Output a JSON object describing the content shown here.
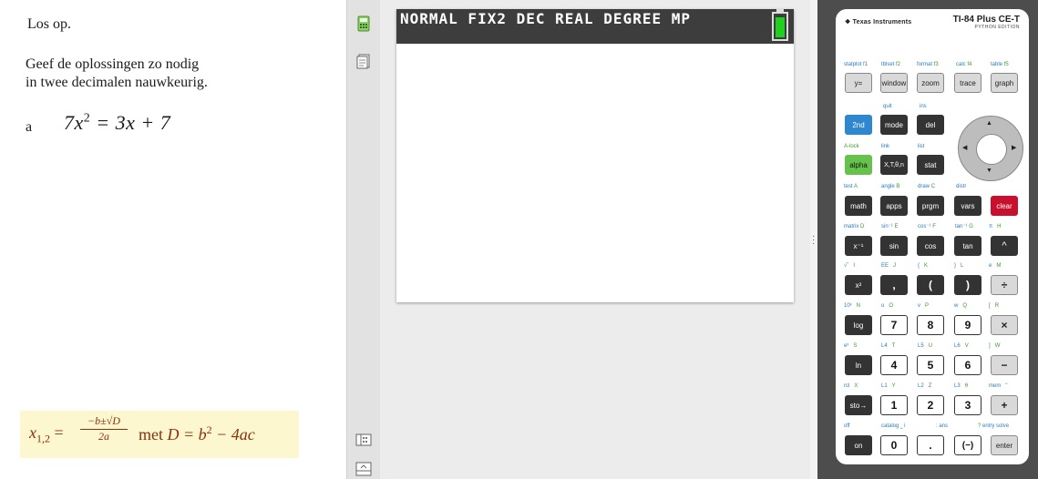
{
  "left": {
    "instruction": "Los op.",
    "precision_line1": "Geef de oplossingen zo nodig",
    "precision_line2": "in twee decimalen nauwkeurig.",
    "question_label": "a",
    "equation_base": "7x",
    "equation_exp": "2",
    "equation_rest": " = 3x + 7",
    "formula_lhs": "x",
    "formula_sub": "1,2",
    "formula_eq": " =",
    "formula_num": "−b±√D",
    "formula_den": "2a",
    "formula_met": "met",
    "formula_D": "D = b",
    "formula_D_exp": "2",
    "formula_D_rest": " − 4ac"
  },
  "screen": {
    "status": "NORMAL FIX2 DEC REAL DEGREE MP"
  },
  "calc": {
    "brand": "Texas Instruments",
    "model": "TI-84 Plus CE-T",
    "edition": "PYTHON EDITION",
    "labels": {
      "statplot": "statplot",
      "f1": "f1",
      "tblset": "tblset",
      "f2": "f2",
      "format": "format",
      "f3": "f3",
      "calc": "calc",
      "f4": "f4",
      "table": "table",
      "f5": "f5",
      "quit": "quit",
      "ins": "ins",
      "alock": "A-lock",
      "link": "link",
      "list": "list",
      "test": "test",
      "A": "A",
      "angle": "angle",
      "B": "B",
      "draw": "draw",
      "C": "C",
      "distr": "distr",
      "matrix": "matrix",
      "D": "D",
      "sininv": "sin⁻¹",
      "E": "E",
      "cosinv": "cos⁻¹",
      "F": "F",
      "taninv": "tan⁻¹",
      "G": "G",
      "pi": "π",
      "H": "H",
      "sqrt": "√‾",
      "I": "I",
      "EE": "EE",
      "J": "J",
      "lbrace": "{",
      "K": "K",
      "rbrace": "}",
      "L": "L",
      "e": "e",
      "M": "M",
      "tenx": "10ˣ",
      "N": "N",
      "u": "u",
      "O": "O",
      "v": "v",
      "P": "P",
      "w": "w",
      "Q": "Q",
      "lbracket": "[",
      "R": "R",
      "ex": "eˣ",
      "S": "S",
      "L4": "L4",
      "T": "T",
      "L5": "L5",
      "U": "U",
      "L6": "L6",
      "V": "V",
      "rbracket": "]",
      "W": "W",
      "rcl": "rcl",
      "X": "X",
      "L1": "L1",
      "Y": "Y",
      "L2": "L2",
      "Z": "Z",
      "L3": "L3",
      "theta": "θ",
      "mem": "mem",
      "quote": "\"",
      "off": "off",
      "catalog": "catalog",
      "space": "⎵",
      "i": "i",
      "colon": ":",
      "ans": "ans",
      "q": "?",
      "entrysolve": "entry solve"
    },
    "keys": {
      "y": "y=",
      "window": "window",
      "zoom": "zoom",
      "trace": "trace",
      "graph": "graph",
      "second": "2nd",
      "mode": "mode",
      "del": "del",
      "alpha": "alpha",
      "xt": "X,T,θ,n",
      "stat": "stat",
      "math": "math",
      "apps": "apps",
      "prgm": "prgm",
      "vars": "vars",
      "clear": "clear",
      "xinv": "x⁻¹",
      "sin": "sin",
      "cos": "cos",
      "tan": "tan",
      "caret": "^",
      "x2": "x²",
      "comma": ",",
      "lparen": "(",
      "rparen": ")",
      "div": "÷",
      "log": "log",
      "n7": "7",
      "n8": "8",
      "n9": "9",
      "mul": "×",
      "ln": "ln",
      "n4": "4",
      "n5": "5",
      "n6": "6",
      "minus": "−",
      "sto": "sto→",
      "n1": "1",
      "n2": "2",
      "n3": "3",
      "plus": "+",
      "on": "on",
      "n0": "0",
      "dot": ".",
      "neg": "(−)",
      "enter": "enter"
    }
  }
}
